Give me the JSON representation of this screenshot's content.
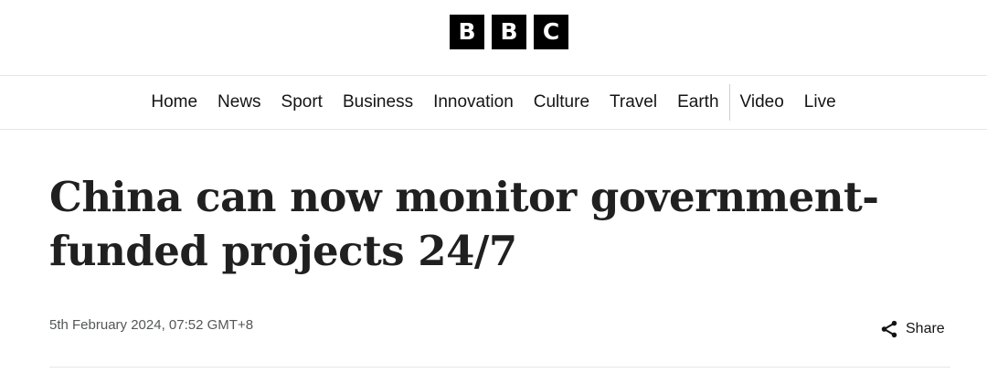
{
  "logo": {
    "letters": [
      "B",
      "B",
      "C"
    ]
  },
  "nav": {
    "items": [
      "Home",
      "News",
      "Sport",
      "Business",
      "Innovation",
      "Culture",
      "Travel",
      "Earth"
    ],
    "secondary_items": [
      "Video",
      "Live"
    ]
  },
  "article": {
    "headline": "China can now monitor government-funded projects 24/7",
    "timestamp": "5th February 2024, 07:52 GMT+8",
    "share_label": "Share"
  },
  "icons": {
    "share": "share-icon"
  }
}
